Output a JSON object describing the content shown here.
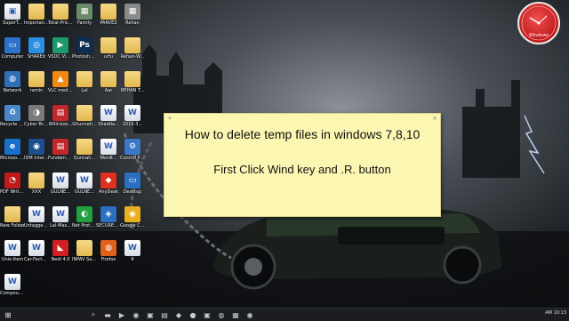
{
  "note": {
    "title": "How to delete temp files in windows 7,8,10",
    "subtitle": "First Click Wind key and .R. button"
  },
  "clock": {
    "label": "Windows"
  },
  "desktop_icons": [
    {
      "label": "SuperT...",
      "kind": "doc",
      "symbol": "▣",
      "color": "#4a7bd0"
    },
    {
      "label": "Important-1-8-2021",
      "kind": "folder",
      "symbol": ""
    },
    {
      "label": "Total-Price-List...",
      "kind": "folder",
      "symbol": ""
    },
    {
      "label": "Family",
      "kind": "image",
      "symbol": "▦",
      "color": "#6a8a6a"
    },
    {
      "label": "PARVEZ",
      "kind": "folder",
      "symbol": ""
    },
    {
      "label": "Rehan",
      "kind": "image",
      "symbol": "▦",
      "color": "#8a8a8a"
    },
    {
      "label": "Computer",
      "kind": "app",
      "symbol": "▭",
      "color": "#2d72c8"
    },
    {
      "label": "SHAREit",
      "kind": "app",
      "symbol": "◎",
      "color": "#2a8fe0"
    },
    {
      "label": "VSDC Video Editor",
      "kind": "app",
      "symbol": "▶",
      "color": "#1d9a6c"
    },
    {
      "label": "Photoshop CS6",
      "kind": "app",
      "symbol": "Ps",
      "color": "#0f2c52"
    },
    {
      "label": "urfu",
      "kind": "folder",
      "symbol": ""
    },
    {
      "label": "Rehan-W...",
      "kind": "folder",
      "symbol": ""
    },
    {
      "label": "Network",
      "kind": "app",
      "symbol": "◍",
      "color": "#2f6fb8"
    },
    {
      "label": "ramin",
      "kind": "folder",
      "symbol": ""
    },
    {
      "label": "VLC media player",
      "kind": "app",
      "symbol": "▲",
      "color": "#f08a10"
    },
    {
      "label": "Lal",
      "kind": "folder",
      "symbol": ""
    },
    {
      "label": "Aar",
      "kind": "folder",
      "symbol": ""
    },
    {
      "label": "REHAN T...",
      "kind": "folder",
      "symbol": ""
    },
    {
      "label": "Recycle Bin",
      "kind": "app",
      "symbol": "♻",
      "color": "#4b88c8"
    },
    {
      "label": "Cyber Brow...",
      "kind": "app",
      "symbol": "◑",
      "color": "#7a7a7a"
    },
    {
      "label": "Wild-boo...",
      "kind": "app",
      "symbol": "▤",
      "color": "#c0282c"
    },
    {
      "label": "Ghunnah...",
      "kind": "folder",
      "symbol": ""
    },
    {
      "label": "Shadda...",
      "kind": "doc",
      "symbol": "W"
    },
    {
      "label": "1010-3...",
      "kind": "doc",
      "symbol": "W"
    },
    {
      "label": "Microso... Edge",
      "kind": "app",
      "symbol": "e",
      "color": "#1a6fc8"
    },
    {
      "label": "IDM Internet...",
      "kind": "app",
      "symbol": "◉",
      "color": "#1d4f8c"
    },
    {
      "label": "Fundamen...",
      "kind": "app",
      "symbol": "▤",
      "color": "#c0282c"
    },
    {
      "label": "Qunnah...",
      "kind": "folder",
      "symbol": ""
    },
    {
      "label": "Wordt...",
      "kind": "doc",
      "symbol": "W"
    },
    {
      "label": "Control Panel",
      "kind": "app",
      "symbol": "⚙",
      "color": "#3a78c8"
    },
    {
      "label": "PDF Writer Pro...",
      "kind": "app",
      "symbol": "◔",
      "color": "#c01a1a"
    },
    {
      "label": "XXX",
      "kind": "folder",
      "symbol": ""
    },
    {
      "label": "GULNE...",
      "kind": "doc",
      "symbol": "W"
    },
    {
      "label": "GULNE...",
      "kind": "doc",
      "symbol": "W"
    },
    {
      "label": "AnyDesk",
      "kind": "app",
      "symbol": "◆",
      "color": "#e03020"
    },
    {
      "label": "Desktop",
      "kind": "app",
      "symbol": "▭",
      "color": "#2a6fc0"
    },
    {
      "label": "New Folder",
      "kind": "folder",
      "symbol": ""
    },
    {
      "label": "Untagged...",
      "kind": "doc",
      "symbol": "W"
    },
    {
      "label": "Lal-Mas...",
      "kind": "doc",
      "symbol": "W"
    },
    {
      "label": "Net Protect...",
      "kind": "app",
      "symbol": "◐",
      "color": "#20a040"
    },
    {
      "label": "SECURESH...",
      "kind": "app",
      "symbol": "◈",
      "color": "#2a6fc0"
    },
    {
      "label": "Google Chrome",
      "kind": "app",
      "symbol": "◉",
      "color": "#e8b020"
    },
    {
      "label": "Unix-Item",
      "kind": "doc",
      "symbol": "W"
    },
    {
      "label": "Car-Facto...",
      "kind": "doc",
      "symbol": "W"
    },
    {
      "label": "Nedi 4.0",
      "kind": "app",
      "symbol": "◣",
      "color": "#d02020"
    },
    {
      "label": "INPAV Saved Updates 1...",
      "kind": "folder",
      "symbol": ""
    },
    {
      "label": "Firefox",
      "kind": "app",
      "symbol": "◍",
      "color": "#e0601a"
    },
    {
      "label": "9",
      "kind": "doc",
      "symbol": "W"
    },
    {
      "label": "Compound...",
      "kind": "doc",
      "symbol": "W"
    }
  ],
  "taskbar": {
    "tray_time": "AM 10:13",
    "items": [
      {
        "name": "start",
        "symbol": "⊞"
      },
      {
        "name": "search",
        "symbol": "⌕"
      },
      {
        "name": "folder",
        "symbol": "▬"
      },
      {
        "name": "media",
        "symbol": "▶"
      },
      {
        "name": "browser",
        "symbol": "◉"
      },
      {
        "name": "app",
        "symbol": "▣"
      },
      {
        "name": "app",
        "symbol": "▤"
      },
      {
        "name": "app",
        "symbol": "◆"
      },
      {
        "name": "app",
        "symbol": "●"
      },
      {
        "name": "app",
        "symbol": "▣"
      },
      {
        "name": "app",
        "symbol": "◍"
      },
      {
        "name": "app",
        "symbol": "▦"
      },
      {
        "name": "recorder",
        "symbol": "◉"
      }
    ]
  }
}
